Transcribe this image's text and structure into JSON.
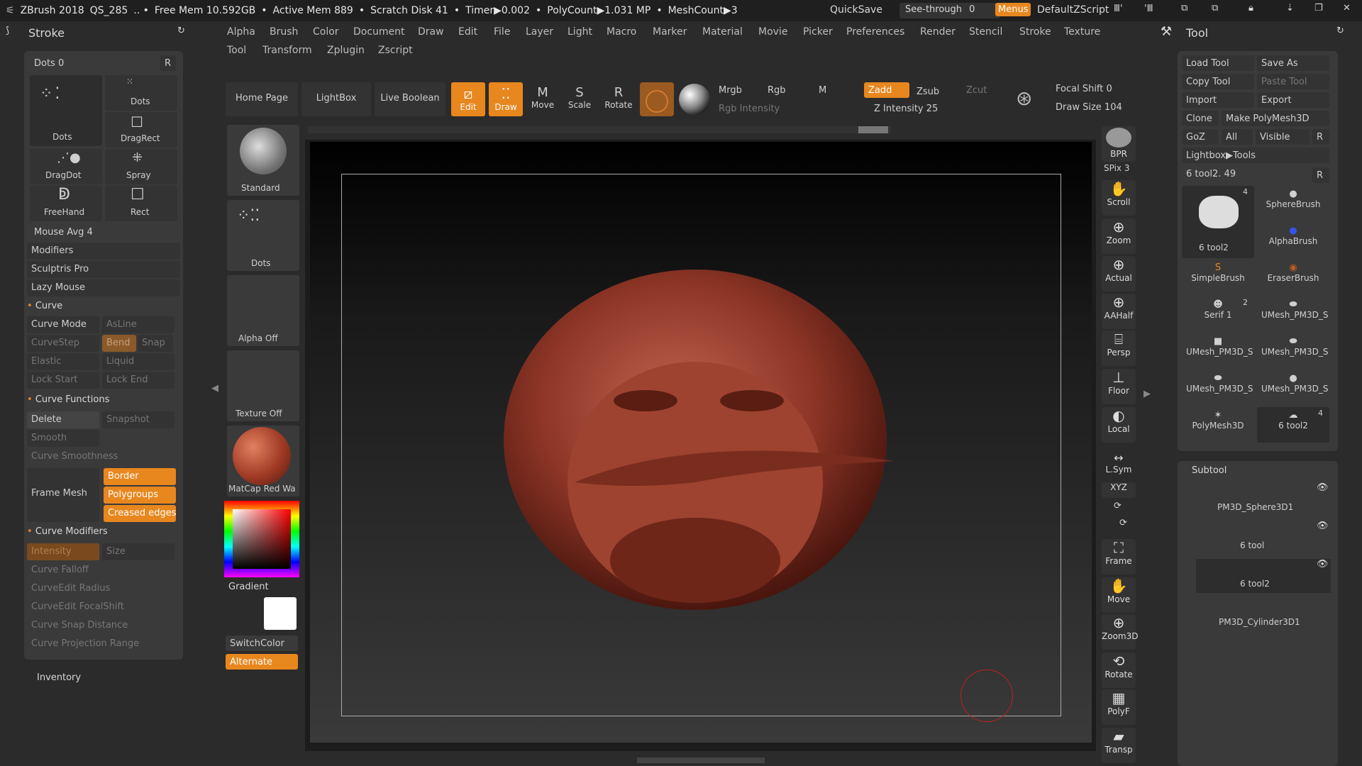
{
  "topbar": {
    "app": "ZBrush 2018",
    "doc": "QS_285",
    "free_mem": "Free Mem 10.592GB",
    "active_mem": "Active Mem 889",
    "scratch": "Scratch Disk 41",
    "timer": "Timer▶0.002",
    "polycount": "PolyCount▶1.031 MP",
    "meshcount": "MeshCount▶3",
    "quicksave": "QuickSave",
    "see_through": "See-through",
    "see_through_value": "0",
    "menus": "Menus",
    "defaultz": "DefaultZScript"
  },
  "menus": [
    "Alpha",
    "Brush",
    "Color",
    "Document",
    "Draw",
    "Edit",
    "File",
    "Layer",
    "Light",
    "Macro",
    "Marker",
    "Material",
    "Movie",
    "Picker",
    "Preferences",
    "Render",
    "Stencil",
    "Stroke",
    "Texture",
    "Tool",
    "Transform",
    "Zplugin",
    "Zscript"
  ],
  "left": {
    "title": "Stroke",
    "dots": "Dots 0",
    "r": "R",
    "items": [
      "Dots",
      "Dots",
      "DragRect",
      "DragDot",
      "Spray",
      "FreeHand",
      "Rect"
    ],
    "mouse_avg": "Mouse Avg",
    "mouse_avg_val": "4",
    "sections": [
      "Modifiers",
      "Sculptris Pro",
      "Lazy Mouse"
    ],
    "curve": "Curve",
    "curve_mode": "Curve Mode",
    "asline": "AsLine",
    "curvestep": "CurveStep",
    "bend": "Bend",
    "snap": "Snap",
    "elastic": "Elastic",
    "liquid": "Liquid",
    "lock_start": "Lock Start",
    "lock_end": "Lock End",
    "curve_functions": "Curve Functions",
    "delete": "Delete",
    "snapshot": "Snapshot",
    "smooth": "Smooth",
    "curve_smoothness": "Curve Smoothness",
    "frame_mesh": "Frame Mesh",
    "border": "Border",
    "polygroups": "Polygroups",
    "creased": "Creased edges",
    "curve_modifiers": "Curve Modifiers",
    "intensity": "Intensity",
    "size": "Size",
    "curve_falloff": "Curve Falloff",
    "curveedit_radius": "CurveEdit Radius",
    "curveedit_focal": "CurveEdit FocalShift",
    "snap_distance": "Curve Snap Distance",
    "projection": "Curve Projection Range",
    "inventory": "Inventory"
  },
  "shelf": {
    "home": "Home Page",
    "lightbox": "LightBox",
    "live_boolean": "Live Boolean",
    "edit": "Edit",
    "draw": "Draw",
    "move": "Move",
    "scale": "Scale",
    "rotate": "Rotate",
    "mrgb": "Mrgb",
    "rgb": "Rgb",
    "m": "M",
    "zadd": "Zadd",
    "zsub": "Zsub",
    "zcut": "Zcut",
    "rgb_intensity": "Rgb Intensity",
    "z_intensity": "Z Intensity",
    "z_intensity_val": "25",
    "focal_shift": "Focal Shift",
    "focal_shift_val": "0",
    "draw_size": "Draw Size",
    "draw_size_val": "104"
  },
  "brushcol": {
    "standard": "Standard",
    "dots": "Dots",
    "alpha": "Alpha Off",
    "texture": "Texture Off",
    "matcap": "MatCap Red Wa",
    "gradient": "Gradient",
    "switchcolor": "SwitchColor",
    "alternate": "Alternate"
  },
  "rightcol": [
    "BPR",
    "SPix 3",
    "Scroll",
    "Zoom",
    "Actual",
    "AAHalf",
    "Persp",
    "Floor",
    "Local",
    "L.Sym",
    "XYZ",
    "Frame",
    "Move",
    "Zoom3D",
    "Rotate",
    "PolyF",
    "Transp"
  ],
  "tool": {
    "title": "Tool",
    "load": "Load Tool",
    "save_as": "Save As",
    "copy": "Copy Tool",
    "paste": "Paste Tool",
    "import": "Import",
    "export": "Export",
    "clone": "Clone",
    "make_poly": "Make PolyMesh3D",
    "goz": "GoZ",
    "all": "All",
    "visible": "Visible",
    "r": "R",
    "lightbox_tools": "Lightbox▶Tools",
    "tool_val": "6 tool2. 49",
    "thumbs": [
      "6 tool2",
      "SphereBrush",
      "AlphaBrush",
      "SimpleBrush",
      "EraserBrush",
      "Serif 1",
      "UMesh_PM3D_S",
      "UMesh_PM3D_S",
      "UMesh_PM3D_S",
      "UMesh_PM3D_S",
      "UMesh_PM3D_S",
      "PolyMesh3D",
      "6 tool2"
    ],
    "badge4": "4",
    "badge2": "2",
    "subtool": "Subtool",
    "subtools": [
      "PM3D_Sphere3D1",
      "6 tool",
      "6 tool2",
      "PM3D_Cylinder3D1"
    ]
  }
}
